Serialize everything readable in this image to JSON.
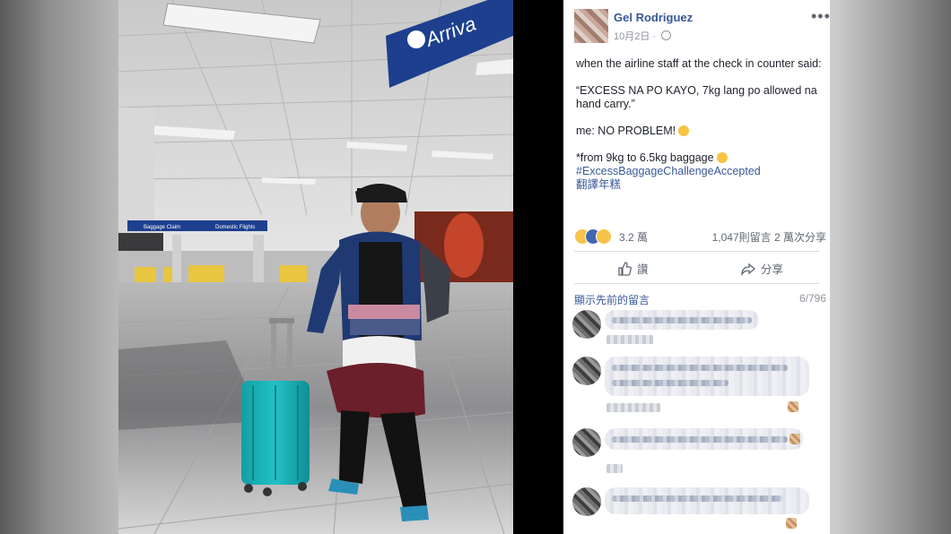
{
  "post": {
    "author": "Gel Rodriguez",
    "date": "10月2日",
    "date_sep": "·",
    "more_icon": "more-horizontal-icon",
    "text": {
      "line1": "when the airline staff at the check in counter said:",
      "line2": "“EXCESS NA PO KAYO, 7kg lang po allowed na hand carry.”",
      "line3": "me: NO PROBLEM!",
      "line4": "*from 9kg to 6.5kg baggage",
      "hashtag": "#ExcessBaggageChallengeAccepted",
      "translate": "翻譯年糕"
    },
    "reactions": {
      "icons": [
        "haha-reaction-icon",
        "like-reaction-icon",
        "wow-reaction-icon"
      ],
      "count": "3.2 萬",
      "comments": "1,047則留言",
      "shares": "2 萬次分享"
    },
    "actions": {
      "like_label": "讚",
      "share_label": "分享"
    },
    "comments_bar": {
      "show_previous": "顯示先前的留言",
      "counter": "6/796"
    }
  },
  "photo": {
    "sign_text": "Arriva",
    "sign_small_left": "Baggage Claim",
    "sign_small_right": "Domestic Flights"
  },
  "colors": {
    "link": "#385898",
    "luggage": "#1ab3b8",
    "panel_bg": "#ffffff"
  }
}
